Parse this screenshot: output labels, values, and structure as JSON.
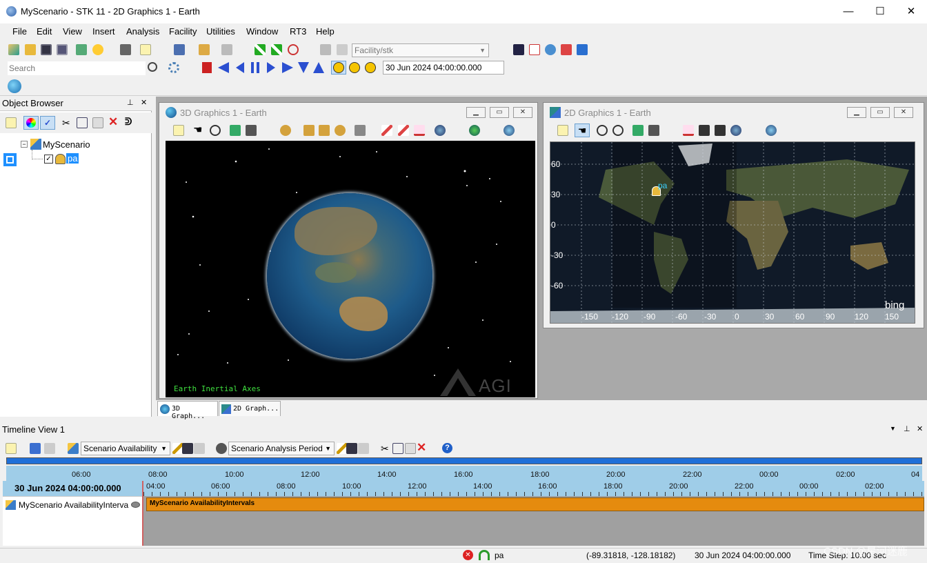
{
  "app": {
    "title": "MyScenario - STK 11 - 2D Graphics 1 - Earth",
    "min_glyph": "—",
    "max_glyph": "☐",
    "close_glyph": "✕"
  },
  "menu": [
    "File",
    "Edit",
    "View",
    "Insert",
    "Analysis",
    "Facility",
    "Utilities",
    "Window",
    "RT3",
    "Help"
  ],
  "toolbar": {
    "object_combo": "Facility/stk",
    "search_placeholder": "Search",
    "time_field": "30 Jun 2024 04:00:00.000"
  },
  "object_browser": {
    "title": "Object Browser",
    "root": "MyScenario",
    "child": "pa"
  },
  "win3d": {
    "title": "3D Graphics 1 - Earth",
    "axes_label": "Earth Inertial Axes",
    "watermark": "AGI"
  },
  "win2d": {
    "title": "2D Graphics 1 - Earth",
    "lat_labels": [
      "60",
      "30",
      "0",
      "-30",
      "-60"
    ],
    "lon_labels": [
      "-150",
      "-120",
      "-90",
      "-60",
      "-30",
      "0",
      "30",
      "60",
      "90",
      "120",
      "150"
    ],
    "facility_label": "pa",
    "bing_label": "bing"
  },
  "doc_tabs": [
    "3D Graph...",
    "2D Graph..."
  ],
  "timeline": {
    "title": "Timeline View 1",
    "availability_combo": "Scenario Availability",
    "analysis_combo": "Scenario Analysis Period",
    "overview_ticks": [
      "06:00",
      "08:00",
      "10:00",
      "12:00",
      "14:00",
      "16:00",
      "18:00",
      "20:00",
      "22:00",
      "00:00",
      "02:00"
    ],
    "overview_end": "04",
    "current_time": "30 Jun 2024 04:00:00.000",
    "detail_ticks": [
      "04:00",
      "06:00",
      "08:00",
      "10:00",
      "12:00",
      "14:00",
      "16:00",
      "18:00",
      "20:00",
      "22:00",
      "00:00",
      "02:00"
    ],
    "row_label": "MyScenario AvailabilityInterva",
    "bar_label": "MyScenario AvailabilityIntervals"
  },
  "status": {
    "object": "pa",
    "coords": "(-89.31818, -128.18182)",
    "time": "30 Jun 2024 04:00:00.000",
    "timestep": "Time Step: 10.00 sec",
    "watermark": "CSDN @星河迷鹿"
  },
  "colors": {
    "accent_blue": "#1f6fd8",
    "availability_bar": "#e58b0e",
    "timeline_ruler": "#9fcde8",
    "axes_green": "#3fe03f"
  }
}
